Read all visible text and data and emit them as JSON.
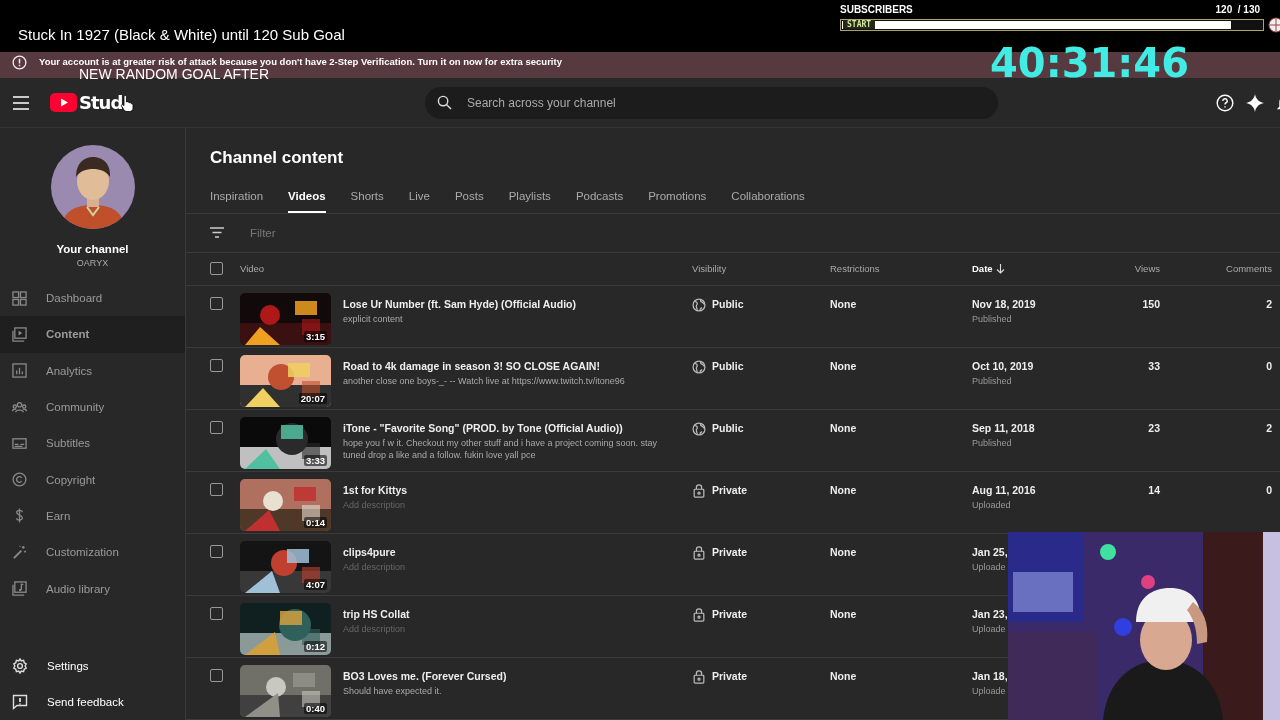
{
  "stream_overlay": {
    "title": "Stuck In 1927 (Black & White) until 120 Sub Goal",
    "subscribers_label": "SUBSCRIBERS",
    "count": "120  / 130",
    "goal_bar": {
      "label": "START",
      "level": 0.93
    },
    "goal_note": "NEW RANDOM GOAL AFTER",
    "timer": "40:31:46"
  },
  "banner": {
    "text": "Your account is at greater risk of attack because you don't have 2-Step Verification. Turn it on now for extra security"
  },
  "header": {
    "logo": "Stud",
    "search": {
      "placeholder": "Search across your channel"
    }
  },
  "sidebar": {
    "channel_title": "Your channel",
    "handle": "OARYX",
    "items": [
      {
        "label": "Dashboard",
        "selected": false
      },
      {
        "label": "Content",
        "selected": true
      },
      {
        "label": "Analytics",
        "selected": false
      },
      {
        "label": "Community",
        "selected": false
      },
      {
        "label": "Subtitles",
        "selected": false
      },
      {
        "label": "Copyright",
        "selected": false
      },
      {
        "label": "Earn",
        "selected": false
      },
      {
        "label": "Customization",
        "selected": false
      },
      {
        "label": "Audio library",
        "selected": false
      }
    ],
    "footer_items": [
      {
        "label": "Settings"
      },
      {
        "label": "Send feedback"
      }
    ]
  },
  "page_title": "Channel content",
  "tabs": [
    {
      "label": "Inspiration",
      "selected": false
    },
    {
      "label": "Videos",
      "selected": true
    },
    {
      "label": "Shorts",
      "selected": false
    },
    {
      "label": "Live",
      "selected": false
    },
    {
      "label": "Posts",
      "selected": false
    },
    {
      "label": "Playlists",
      "selected": false
    },
    {
      "label": "Podcasts",
      "selected": false
    },
    {
      "label": "Promotions",
      "selected": false
    },
    {
      "label": "Collaborations",
      "selected": false
    }
  ],
  "filter": {
    "placeholder": "Filter"
  },
  "table": {
    "select_all_checked": false,
    "columns": [
      {
        "label": "Video",
        "sorted": false
      },
      {
        "label": "Visibility",
        "sorted": false
      },
      {
        "label": "Restrictions",
        "sorted": false
      },
      {
        "label": "Date",
        "sorted": true
      },
      {
        "label": "Views",
        "sorted": false
      },
      {
        "label": "Comments",
        "sorted": false
      }
    ],
    "rows": [
      {
        "checked": false,
        "duration": "3:15",
        "title": "Lose Ur Number (ft. Sam Hyde) (Official Audio)",
        "description": "explicit content",
        "visibility": {
          "kind": "public",
          "label": "Public"
        },
        "restrictions": "None",
        "date": "Nov 18, 2019",
        "status": "Published",
        "views": "150",
        "comments": "2"
      },
      {
        "checked": false,
        "duration": "20:07",
        "title": "Road to 4k damage in season 3! SO CLOSE AGAIN!",
        "description": "another close one boys-_- -- Watch live at https://www.twitch.tv/itone96",
        "visibility": {
          "kind": "public",
          "label": "Public"
        },
        "restrictions": "None",
        "date": "Oct 10, 2019",
        "status": "Published",
        "views": "33",
        "comments": "0"
      },
      {
        "checked": false,
        "duration": "3:33",
        "title": "iTone - \"Favorite Song\" (PROD. by Tone (Official Audio))",
        "description": "hope you f w it. Checkout my other stuff and i have a project coming soon. stay tuned drop a like and a follow. fukin love yall pce",
        "visibility": {
          "kind": "public",
          "label": "Public"
        },
        "restrictions": "None",
        "date": "Sep 11, 2018",
        "status": "Published",
        "views": "23",
        "comments": "2"
      },
      {
        "checked": false,
        "duration": "0:14",
        "title": "1st for Kittys",
        "hint": "Add description",
        "visibility": {
          "kind": "private",
          "label": "Private"
        },
        "restrictions": "None",
        "date": "Aug 11, 2016",
        "status": "Uploaded",
        "views": "14",
        "comments": "0"
      },
      {
        "checked": false,
        "duration": "4:07",
        "title": "clips4pure",
        "hint": "Add description",
        "visibility": {
          "kind": "private",
          "label": "Private"
        },
        "restrictions": "None",
        "date": "Jan 25,",
        "status": "Uploade"
      },
      {
        "checked": false,
        "duration": "0:12",
        "title": "trip HS Collat",
        "hint": "Add description",
        "visibility": {
          "kind": "private",
          "label": "Private"
        },
        "restrictions": "None",
        "date": "Jan 23,",
        "status": "Uploade"
      },
      {
        "checked": false,
        "duration": "0:40",
        "title": "BO3 Loves me. (Forever Cursed)",
        "description": "Should have expected it.",
        "visibility": {
          "kind": "private",
          "label": "Private"
        },
        "restrictions": "None",
        "date": "Jan 18,",
        "status": "Uploade"
      }
    ]
  }
}
